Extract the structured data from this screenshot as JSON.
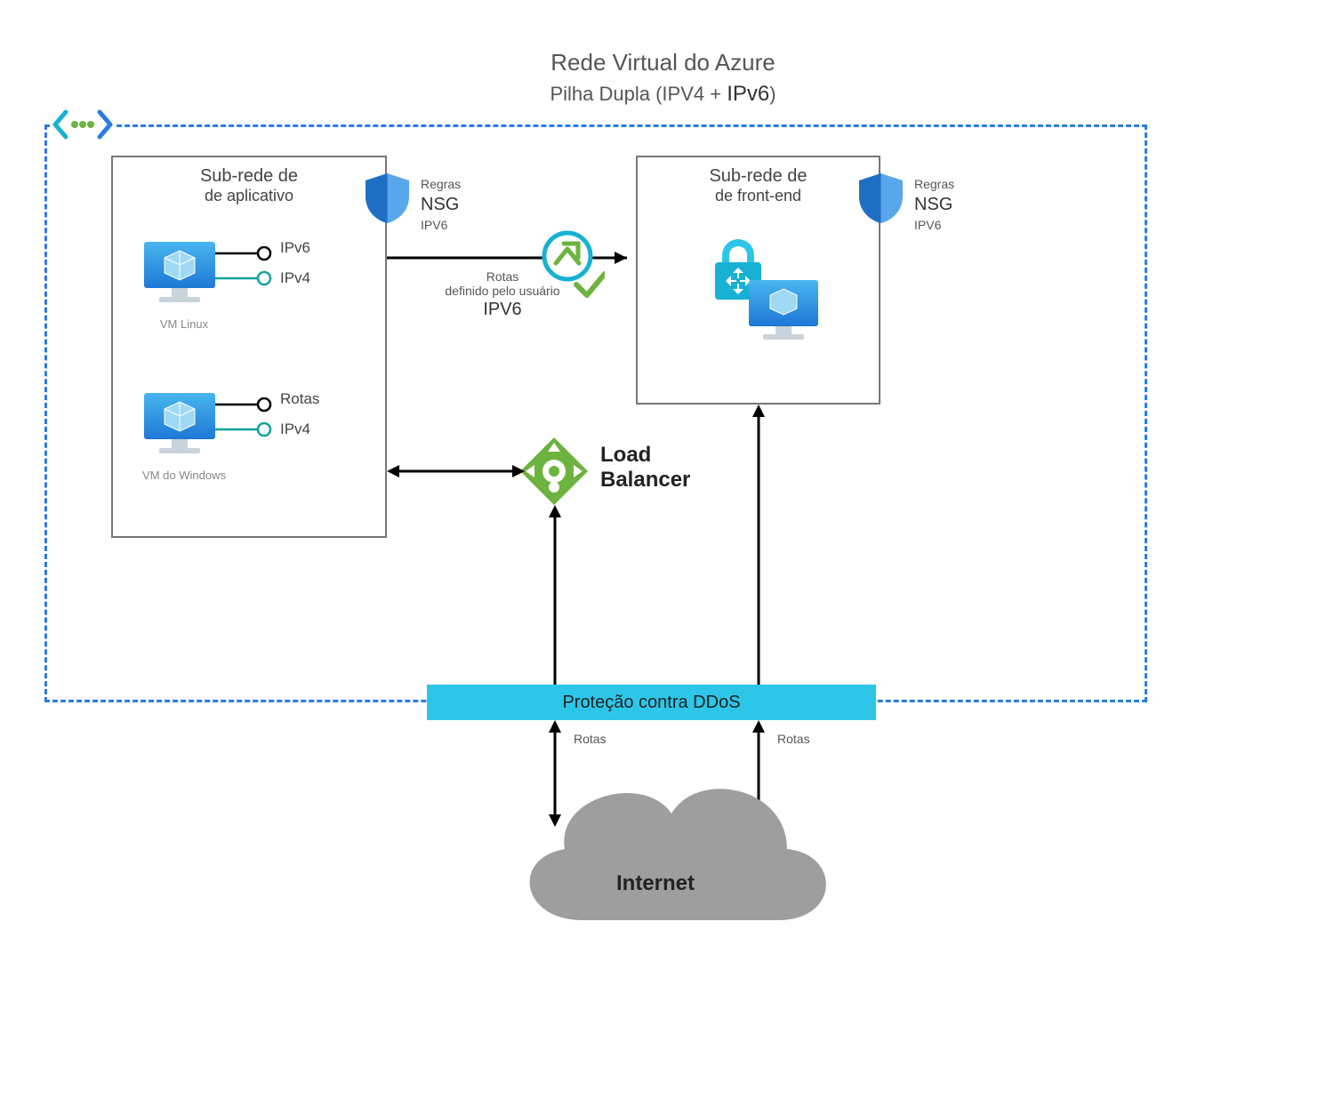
{
  "title": "Rede Virtual do Azure",
  "subtitle_prefix": "Pilha Dupla (IPV4 + ",
  "subtitle_ipv6": "IPv6",
  "subtitle_suffix": ")",
  "app_subnet": {
    "line1": "Sub-rede de",
    "line2": "de aplicativo"
  },
  "fe_subnet": {
    "line1": "Sub-rede de",
    "line2": "de front-end"
  },
  "vm_linux": {
    "caption": "VM Linux",
    "port1": "IPv6",
    "port2": "IPv4"
  },
  "vm_windows": {
    "caption": "VM do Windows",
    "port1": "Rotas",
    "port2": "IPv4"
  },
  "nsg": {
    "small": "Regras",
    "main": "NSG",
    "sub": "IPV6"
  },
  "routes": {
    "small1": "Rotas",
    "small2": "definido pelo usuário",
    "main": "IPV6"
  },
  "load_balancer": {
    "line1": "Load",
    "line2": "Balancer"
  },
  "ddos": "Proteção contra DDoS",
  "rotas_left": "Rotas",
  "rotas_right": "Rotas",
  "internet": "Internet",
  "icons": {
    "vnet": "vnet-peering-icon",
    "shield": "shield-icon",
    "monitor_vm": "vm-monitor-icon",
    "dot_hollow": "port-ipv6-dot",
    "dot_teal": "port-ipv4-dot",
    "route_circle": "express-route-icon",
    "checkmark": "check-icon",
    "lock_lb": "nat-lock-icon",
    "lb_diamond": "load-balancer-icon",
    "cloud": "internet-cloud-icon"
  },
  "colors": {
    "azure_blue": "#2a7de1",
    "cyan": "#2ec6e8",
    "green": "#6db33f",
    "shield_dark": "#1f6fc4",
    "shield_light": "#58a7ea",
    "gray_cloud": "#9e9e9e"
  }
}
